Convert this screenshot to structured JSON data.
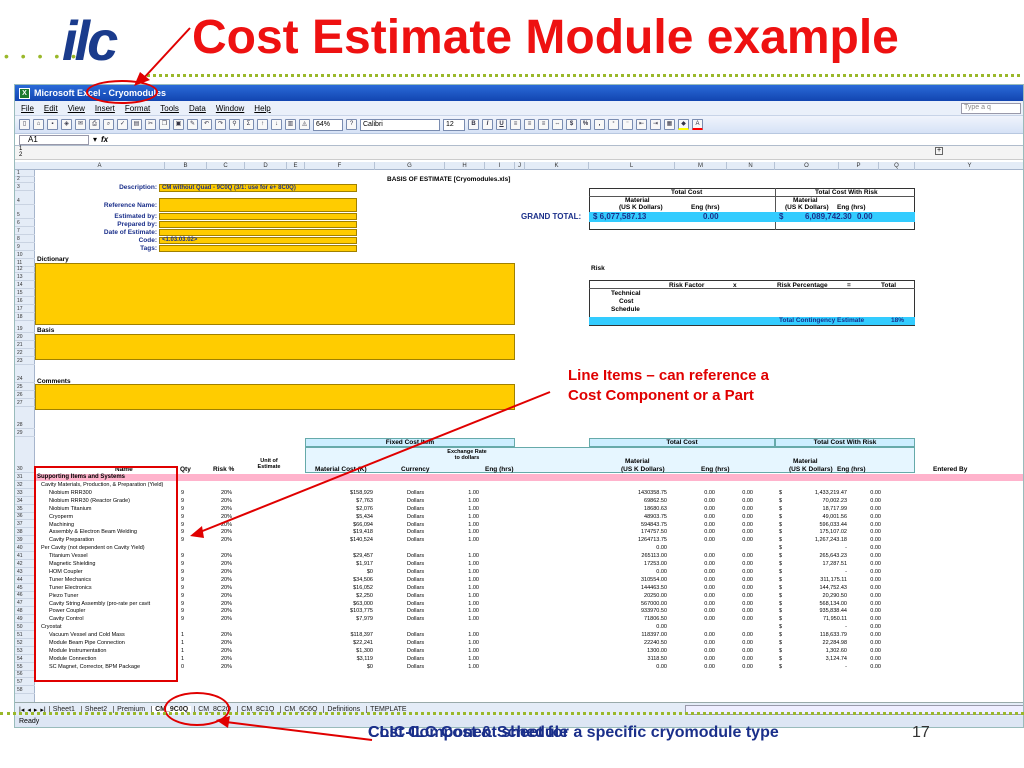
{
  "slide": {
    "logo_text": "ilc",
    "title": "Cost Estimate Module example",
    "note_line_items": [
      "Line Items – can reference a",
      "Cost Component or a Part"
    ],
    "note_bottom": "Cost Component sheet for a specific cryomodule type",
    "footer_overlap": "CLIC-ILC Cost & Schedule",
    "slide_number": "17",
    "accent_red": "#ee1111",
    "accent_blue": "#1a2f8a"
  },
  "excel": {
    "window_title": "Microsoft Excel - Cryomodules",
    "menu": [
      "File",
      "Edit",
      "View",
      "Insert",
      "Format",
      "Tools",
      "Data",
      "Window",
      "Help"
    ],
    "help_placeholder": "Type a q",
    "zoom": "64%",
    "font_name": "Calibri",
    "font_size": "12",
    "name_box": "A1",
    "fx": "fx",
    "status": "Ready",
    "columns": [
      "A",
      "B",
      "C",
      "D",
      "E",
      "F",
      "G",
      "H",
      "I",
      "J",
      "K",
      "L",
      "M",
      "N",
      "O",
      "P",
      "Q",
      "Y"
    ],
    "header_block": {
      "description_label": "Description:",
      "description_value": "CM without Quad - 9C0Q (3/1: use for e+ 8C0Q)",
      "reference_label": "Reference Name:",
      "estimated_label": "Estimated by:",
      "prepared_label": "Prepared by:",
      "date_label": "Date of Estimate:",
      "code_label": "Code:",
      "code_value": "<1.03.03.02>",
      "tags_label": "Tags:",
      "basis_title": "BASIS OF ESTIMATE [Cryomodules.xls]",
      "dictionary": "Dictionary",
      "basis": "Basis",
      "comments": "Comments"
    },
    "totals": {
      "total_cost": "Total Cost",
      "total_cost_with_risk": "Total Cost With Risk",
      "material": "Material",
      "us_k_dollars": "(US K Dollars)",
      "eng_hrs": "Eng (hrs)",
      "grand_total_label": "GRAND TOTAL:",
      "grand_total_material": "$  6,077,587.13",
      "grand_total_eng": "0.00",
      "grand_total_risk_sign": "$",
      "grand_total_risk_material": "6,089,742.30",
      "grand_total_risk_eng": "0.00"
    },
    "risk": {
      "title": "Risk",
      "risk_factor": "Risk Factor",
      "x": "x",
      "risk_percentage": "Risk Percentage",
      "eq": "=",
      "total": "Total",
      "rows": [
        "Technical",
        "Cost",
        "Schedule"
      ],
      "contingency_label": "Total Contingency Estimate",
      "contingency_value": "18%"
    },
    "table_headers": {
      "fixed_cost": "Fixed Cost Item",
      "exchange_rate": "Exchange Rate to dollars",
      "name": "Name",
      "qty": "Qty",
      "risk_pct": "Risk %",
      "unit_estimate": "Unit of Estimate",
      "material_cost_k": "Material Cost (K)",
      "currency": "Currency",
      "eng_hrs": "Eng (hrs)",
      "total_cost": "Total Cost",
      "total_cost_risk": "Total Cost With Risk",
      "material": "Material",
      "us_k_dollars": "(US K Dollars)",
      "entered_by": "Entered By"
    },
    "section_header": "Supporting Items and Systems",
    "items": [
      {
        "name": "Cavity Materials, Production, & Preparation (Yield)",
        "qty": "",
        "risk": "",
        "mat": "",
        "cur": "",
        "rate": "",
        "tc": "",
        "te": "",
        "tn": "",
        "rc": "",
        "re": ""
      },
      {
        "name": "Niobium RRR300",
        "qty": "9",
        "risk": "20%",
        "mat": "$158,929",
        "cur": "Dollars",
        "rate": "1.00",
        "tc": "1430358.75",
        "te": "0.00",
        "tn": "0.00",
        "rc": "1,433,219.47",
        "re": "0.00"
      },
      {
        "name": "Niobium RRR30 (Reactor Grade)",
        "qty": "9",
        "risk": "20%",
        "mat": "$7,763",
        "cur": "Dollars",
        "rate": "1.00",
        "tc": "69862.50",
        "te": "0.00",
        "tn": "0.00",
        "rc": "70,002.23",
        "re": "0.00"
      },
      {
        "name": "Niobium Titanium",
        "qty": "9",
        "risk": "20%",
        "mat": "$2,076",
        "cur": "Dollars",
        "rate": "1.00",
        "tc": "18680.63",
        "te": "0.00",
        "tn": "0.00",
        "rc": "18,717.99",
        "re": "0.00"
      },
      {
        "name": "Cryoperm",
        "qty": "9",
        "risk": "20%",
        "mat": "$5,434",
        "cur": "Dollars",
        "rate": "1.00",
        "tc": "48903.75",
        "te": "0.00",
        "tn": "0.00",
        "rc": "49,001.56",
        "re": "0.00"
      },
      {
        "name": "Machining",
        "qty": "9",
        "risk": "20%",
        "mat": "$66,094",
        "cur": "Dollars",
        "rate": "1.00",
        "tc": "594843.75",
        "te": "0.00",
        "tn": "0.00",
        "rc": "596,033.44",
        "re": "0.00"
      },
      {
        "name": "Assembly & Electron Beam Welding",
        "qty": "9",
        "risk": "20%",
        "mat": "$19,418",
        "cur": "Dollars",
        "rate": "1.00",
        "tc": "174757.50",
        "te": "0.00",
        "tn": "0.00",
        "rc": "175,107.02",
        "re": "0.00"
      },
      {
        "name": "Cavity Preparation",
        "qty": "9",
        "risk": "20%",
        "mat": "$140,524",
        "cur": "Dollars",
        "rate": "1.00",
        "tc": "1264713.75",
        "te": "0.00",
        "tn": "0.00",
        "rc": "1,267,243.18",
        "re": "0.00"
      },
      {
        "name": "Per Cavity (not dependent on Cavity Yield)",
        "qty": "",
        "risk": "",
        "mat": "",
        "cur": "",
        "rate": "",
        "tc": "0.00",
        "te": "",
        "tn": "",
        "rc": "-",
        "re": "0.00"
      },
      {
        "name": "Titanium Vessel",
        "qty": "9",
        "risk": "20%",
        "mat": "$29,457",
        "cur": "Dollars",
        "rate": "1.00",
        "tc": "265113.00",
        "te": "0.00",
        "tn": "0.00",
        "rc": "265,643.23",
        "re": "0.00"
      },
      {
        "name": "Magnetic Shielding",
        "qty": "9",
        "risk": "20%",
        "mat": "$1,917",
        "cur": "Dollars",
        "rate": "1.00",
        "tc": "17253.00",
        "te": "0.00",
        "tn": "0.00",
        "rc": "17,287.51",
        "re": "0.00"
      },
      {
        "name": "HOM Coupler",
        "qty": "9",
        "risk": "20%",
        "mat": "$0",
        "cur": "Dollars",
        "rate": "1.00",
        "tc": "0.00",
        "te": "0.00",
        "tn": "0.00",
        "rc": "-",
        "re": "0.00"
      },
      {
        "name": "Tuner Mechanics",
        "qty": "9",
        "risk": "20%",
        "mat": "$34,506",
        "cur": "Dollars",
        "rate": "1.00",
        "tc": "310554.00",
        "te": "0.00",
        "tn": "0.00",
        "rc": "311,175.11",
        "re": "0.00"
      },
      {
        "name": "Tuner Electronics",
        "qty": "9",
        "risk": "20%",
        "mat": "$16,052",
        "cur": "Dollars",
        "rate": "1.00",
        "tc": "144463.50",
        "te": "0.00",
        "tn": "0.00",
        "rc": "144,752.43",
        "re": "0.00"
      },
      {
        "name": "Piezo Tuner",
        "qty": "9",
        "risk": "20%",
        "mat": "$2,250",
        "cur": "Dollars",
        "rate": "1.00",
        "tc": "20250.00",
        "te": "0.00",
        "tn": "0.00",
        "rc": "20,290.50",
        "re": "0.00"
      },
      {
        "name": "Cavity String Assembly (pro-rate per cavit",
        "qty": "9",
        "risk": "20%",
        "mat": "$63,000",
        "cur": "Dollars",
        "rate": "1.00",
        "tc": "567000.00",
        "te": "0.00",
        "tn": "0.00",
        "rc": "568,134.00",
        "re": "0.00"
      },
      {
        "name": "Power Coupler",
        "qty": "9",
        "risk": "20%",
        "mat": "$103,775",
        "cur": "Dollars",
        "rate": "1.00",
        "tc": "933970.50",
        "te": "0.00",
        "tn": "0.00",
        "rc": "935,838.44",
        "re": "0.00"
      },
      {
        "name": "Cavity Control",
        "qty": "9",
        "risk": "20%",
        "mat": "$7,979",
        "cur": "Dollars",
        "rate": "1.00",
        "tc": "71806.50",
        "te": "0.00",
        "tn": "0.00",
        "rc": "71,950.11",
        "re": "0.00"
      },
      {
        "name": "Cryostat",
        "qty": "",
        "risk": "",
        "mat": "",
        "cur": "",
        "rate": "",
        "tc": "0.00",
        "te": "",
        "tn": "",
        "rc": "-",
        "re": "0.00"
      },
      {
        "name": "Vacuum Vessel and Cold Mass",
        "qty": "1",
        "risk": "20%",
        "mat": "$118,397",
        "cur": "Dollars",
        "rate": "1.00",
        "tc": "118397.00",
        "te": "0.00",
        "tn": "0.00",
        "rc": "118,633.79",
        "re": "0.00"
      },
      {
        "name": "Module Beam Pipe Connection",
        "qty": "1",
        "risk": "20%",
        "mat": "$22,241",
        "cur": "Dollars",
        "rate": "1.00",
        "tc": "22240.50",
        "te": "0.00",
        "tn": "0.00",
        "rc": "22,284.98",
        "re": "0.00"
      },
      {
        "name": "Module Instrumentation",
        "qty": "1",
        "risk": "20%",
        "mat": "$1,300",
        "cur": "Dollars",
        "rate": "1.00",
        "tc": "1300.00",
        "te": "0.00",
        "tn": "0.00",
        "rc": "1,302.60",
        "re": "0.00"
      },
      {
        "name": "Module Connection",
        "qty": "1",
        "risk": "20%",
        "mat": "$3,119",
        "cur": "Dollars",
        "rate": "1.00",
        "tc": "3118.50",
        "te": "0.00",
        "tn": "0.00",
        "rc": "3,124.74",
        "re": "0.00"
      },
      {
        "name": "SC Magnet, Corrector, BPM Package",
        "qty": "0",
        "risk": "20%",
        "mat": "$0",
        "cur": "Dollars",
        "rate": "1.00",
        "tc": "0.00",
        "te": "0.00",
        "tn": "0.00",
        "rc": "-",
        "re": "0.00"
      }
    ],
    "tabs": [
      "Sheet1",
      "Sheet2",
      "Premium",
      "CM_9C0Q",
      "CM_8C2Q",
      "CM_8C1Q",
      "CM_6C6Q",
      "Definitions",
      "TEMPLATE"
    ],
    "active_tab": "CM_9C0Q"
  }
}
